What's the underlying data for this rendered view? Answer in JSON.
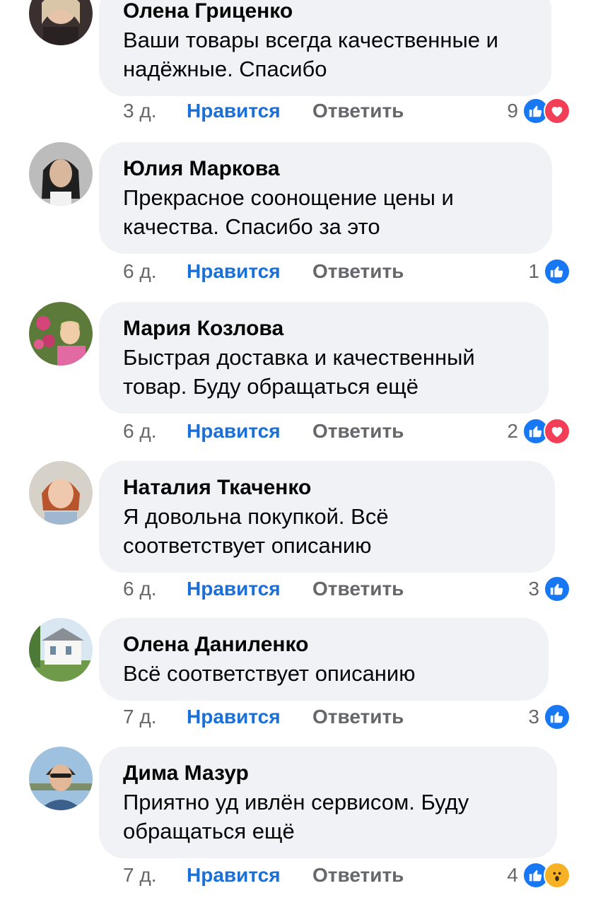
{
  "actions": {
    "like_label": "Нравится",
    "reply_label": "Ответить"
  },
  "colors": {
    "bubble": "#f0f2f5",
    "like_blue": "#1a6fd8",
    "meta_gray": "#65676b",
    "like_reaction": "#1877f2",
    "love_reaction": "#f33e58",
    "wow_reaction": "#f7b125"
  },
  "comments": [
    {
      "author": "Олена Гриценко",
      "text": "Ваши товары всегда качественные и надёжные. Спасибо",
      "time": "3 д.",
      "reactions_count": "9",
      "reactions": [
        "like-icon",
        "love-icon"
      ]
    },
    {
      "author": "Юлия Маркова",
      "text": "Прекрасное соонощение цены и качества. Спасибо за это",
      "time": "6 д.",
      "reactions_count": "1",
      "reactions": [
        "like-icon"
      ]
    },
    {
      "author": "Мария Козлова",
      "text": "Быстрая доставка и качественный товар. Буду обращаться ещё",
      "time": "6 д.",
      "reactions_count": "2",
      "reactions": [
        "like-icon",
        "love-icon"
      ]
    },
    {
      "author": "Наталия Ткаченко",
      "text": "Я довольна покупкой. Всё соответствует описанию",
      "time": "6 д.",
      "reactions_count": "3",
      "reactions": [
        "like-icon"
      ]
    },
    {
      "author": "Олена Даниленко",
      "text": "Всё соответствует описанию",
      "time": "7 д.",
      "reactions_count": "3",
      "reactions": [
        "like-icon"
      ]
    },
    {
      "author": "Дима Мазур",
      "text": "Приятно уд ивлён сервисом. Буду обращаться ещё",
      "time": "7 д.",
      "reactions_count": "4",
      "reactions": [
        "like-icon",
        "wow-icon"
      ]
    }
  ]
}
